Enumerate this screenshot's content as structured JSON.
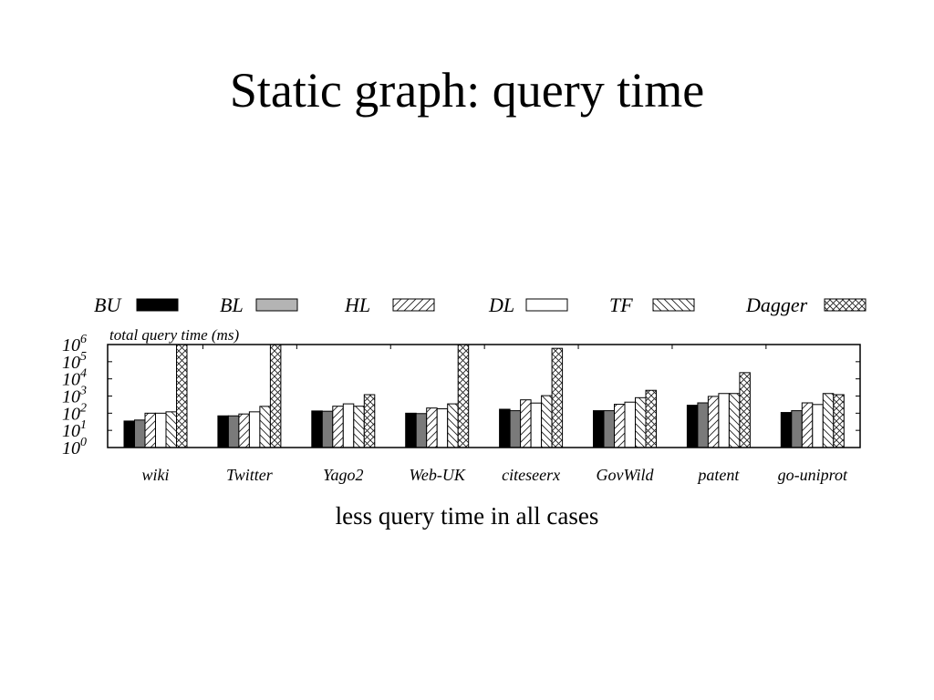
{
  "slide": {
    "title": "Static graph: query time",
    "caption": "less query time in all cases"
  },
  "chart_data": {
    "type": "bar",
    "title": "",
    "ylabel": "total query time (ms)",
    "xlabel": "",
    "yscale": "log",
    "ylim": [
      1,
      1000000
    ],
    "yticks": [
      {
        "base": "10",
        "exp": "0"
      },
      {
        "base": "10",
        "exp": "1"
      },
      {
        "base": "10",
        "exp": "2"
      },
      {
        "base": "10",
        "exp": "3"
      },
      {
        "base": "10",
        "exp": "4"
      },
      {
        "base": "10",
        "exp": "5"
      },
      {
        "base": "10",
        "exp": "6"
      }
    ],
    "legend_position": "top",
    "grid": false,
    "categories": [
      "wiki",
      "Twitter",
      "Yago2",
      "Web-UK",
      "citeseerx",
      "GovWild",
      "patent",
      "go-uniprot"
    ],
    "series": [
      {
        "name": "BU",
        "pattern": "solid-black",
        "values": [
          35,
          70,
          135,
          100,
          170,
          140,
          290,
          110
        ]
      },
      {
        "name": "BL",
        "pattern": "solid-gray",
        "values": [
          40,
          70,
          130,
          95,
          140,
          140,
          400,
          140
        ]
      },
      {
        "name": "HL",
        "pattern": "diagonal-up",
        "values": [
          100,
          90,
          255,
          200,
          600,
          330,
          950,
          400
        ]
      },
      {
        "name": "DL",
        "pattern": "white",
        "values": [
          100,
          120,
          350,
          180,
          390,
          440,
          1400,
          320
        ]
      },
      {
        "name": "TF",
        "pattern": "diagonal-down",
        "values": [
          120,
          250,
          255,
          350,
          1050,
          800,
          1400,
          1400
        ]
      },
      {
        "name": "Dagger",
        "pattern": "crosshatch",
        "values": [
          1000000,
          1000000,
          1200,
          1000000,
          600000,
          2150,
          23000,
          1200
        ]
      }
    ]
  }
}
